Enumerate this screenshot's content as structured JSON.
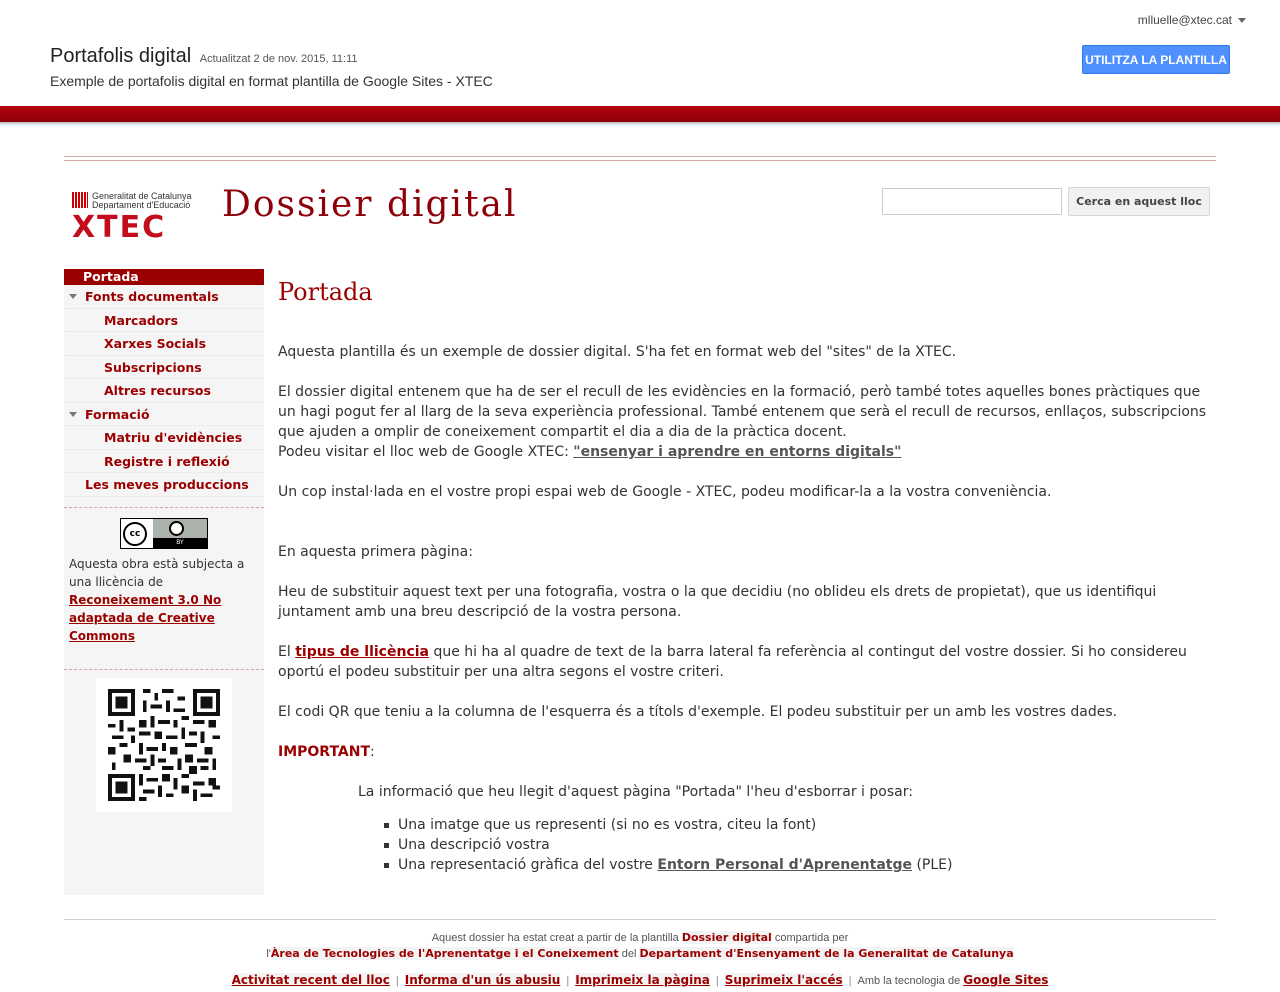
{
  "topbar": {
    "user_email": "mlluelle@xtec.cat",
    "template_title": "Portafolis digital",
    "updated": "Actualitzat 2 de nov. 2015, 11:11",
    "description": "Exemple de portafolis digital en format plantilla de Google Sites - XTEC",
    "use_template_button": "UTILITZA LA PLANTILLA",
    "colors": {
      "button": "#4d90fe",
      "redbar": "#a30009"
    }
  },
  "header": {
    "logo_line1": "Generalitat de Catalunya",
    "logo_line2": "Departament d'Educació",
    "logo_brand": "XTEC",
    "site_title": "Dossier digital",
    "search_placeholder": "",
    "search_button": "Cerca en aquest lloc"
  },
  "sidebar": {
    "nav": [
      {
        "label": "Portada",
        "level": 0,
        "active": true
      },
      {
        "label": "Fonts documentals",
        "level": 1,
        "expanded": true
      },
      {
        "label": "Marcadors",
        "level": 2
      },
      {
        "label": "Xarxes Socials",
        "level": 2
      },
      {
        "label": "Subscripcions",
        "level": 2
      },
      {
        "label": "Altres recursos",
        "level": 2
      },
      {
        "label": "Formació",
        "level": 1,
        "expanded": true
      },
      {
        "label": "Matriu d'evidències",
        "level": 2
      },
      {
        "label": "Registre i reflexió",
        "level": 2
      },
      {
        "label": "Les meves produccions",
        "level": 1
      }
    ],
    "cc_badge": {
      "left": "cc",
      "bottom": "BY"
    },
    "license_text": "Aquesta obra està subjecta a una llicència de",
    "license_link": "Reconeixement 3.0 No adaptada de Creative Commons",
    "qr_icon": "qr-code"
  },
  "main": {
    "page_title": "Portada",
    "p1": "Aquesta plantilla és un exemple de dossier digital. S'ha fet en format web del \"sites\" de la XTEC.",
    "p2": "El dossier digital entenem que ha de ser el recull de les evidències en la formació, però també totes aquelles bones pràctiques que un hagi pogut fer al llarg de la seva experiència professional. També entenem que serà el recull de recursos, enllaços, subscripcions que ajuden a omplir de coneixement compartit el dia a dia de la pràctica docent.",
    "p2_visit": "Podeu visitar el lloc web de Google XTEC:",
    "p2_link": "\"ensenyar i aprendre en entorns digitals\"",
    "p3": "Un cop instal·lada en el vostre propi espai web de Google - XTEC, podeu modificar-la a la vostra conveniència.",
    "p4": "En aquesta primera pàgina:",
    "p5": "Heu de substituir aquest text per una fotografia, vostra o la que decidiu (no oblideu els drets de propietat), que us identifiqui juntament amb una breu descripció de la vostra persona.",
    "p6_pre": "El",
    "p6_link": "tipus de llicència",
    "p6_post": "que hi ha al quadre de text de la barra lateral fa referència al contingut del vostre dossier. Si ho considereu oportú el podeu substituir per una altra segons el vostre criteri.",
    "p7": "El codi QR que teniu a la columna de l'esquerra és a títols d'exemple. El podeu substituir per un amb les vostres dades.",
    "important": "IMPORTANT",
    "important_colon": ":",
    "indent_text": "La informació que heu llegit d'aquest pàgina \"Portada\" l'heu d'esborrar i posar:",
    "bullet1": "Una imatge que us representi (si no es vostra, citeu la font)",
    "bullet2": "Una descripció vostra",
    "bullet3_pre": "Una representació gràfica del vostre",
    "bullet3_link": "Entorn Personal d'Aprenentatge",
    "bullet3_post": "(PLE)"
  },
  "footer": {
    "line1_a": "Aquest dossier ha estat  creat a partir de la plantilla",
    "line1_link": "Dossier digital",
    "line1_b": "compartida per",
    "line2_a": "l'",
    "line2_link1": "Àrea de Tecnologies de l'Aprenentatge i el Coneixement",
    "line2_b": "del",
    "line2_link2": "Departament d'Ensenyament de la Generalitat de Catalunya",
    "links": [
      "Activitat recent del lloc",
      "Informa d'un ús abusiu",
      "Imprimeix la pàgina",
      "Suprimeix l'accés"
    ],
    "powered": "Amb la tecnologia de",
    "powered_link": "Google Sites"
  }
}
